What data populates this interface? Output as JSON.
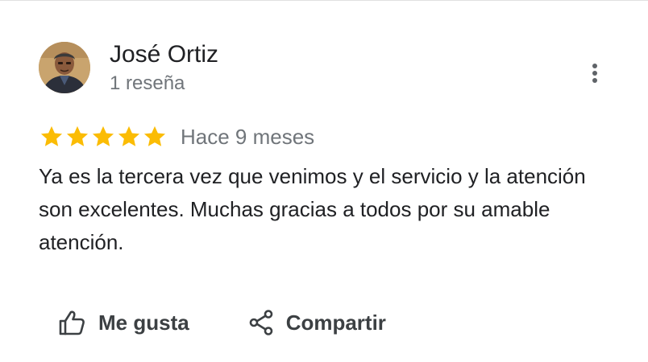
{
  "review": {
    "author_name": "José Ortiz",
    "author_meta": "1 reseña",
    "rating": 5,
    "max_rating": 5,
    "date": "Hace 9 meses",
    "text": "Ya es la tercera vez que venimos y el servicio y la atención son excelentes. Muchas gracias a todos por su amable atención."
  },
  "actions": {
    "like_label": "Me gusta",
    "share_label": "Compartir"
  },
  "icons": {
    "more": "more-vert-icon",
    "star": "star-icon",
    "like": "thumb-up-icon",
    "share": "share-icon"
  },
  "colors": {
    "star": "#fbbc04",
    "primary_text": "#202124",
    "secondary_text": "#70757a",
    "action_text": "#3c4043"
  }
}
